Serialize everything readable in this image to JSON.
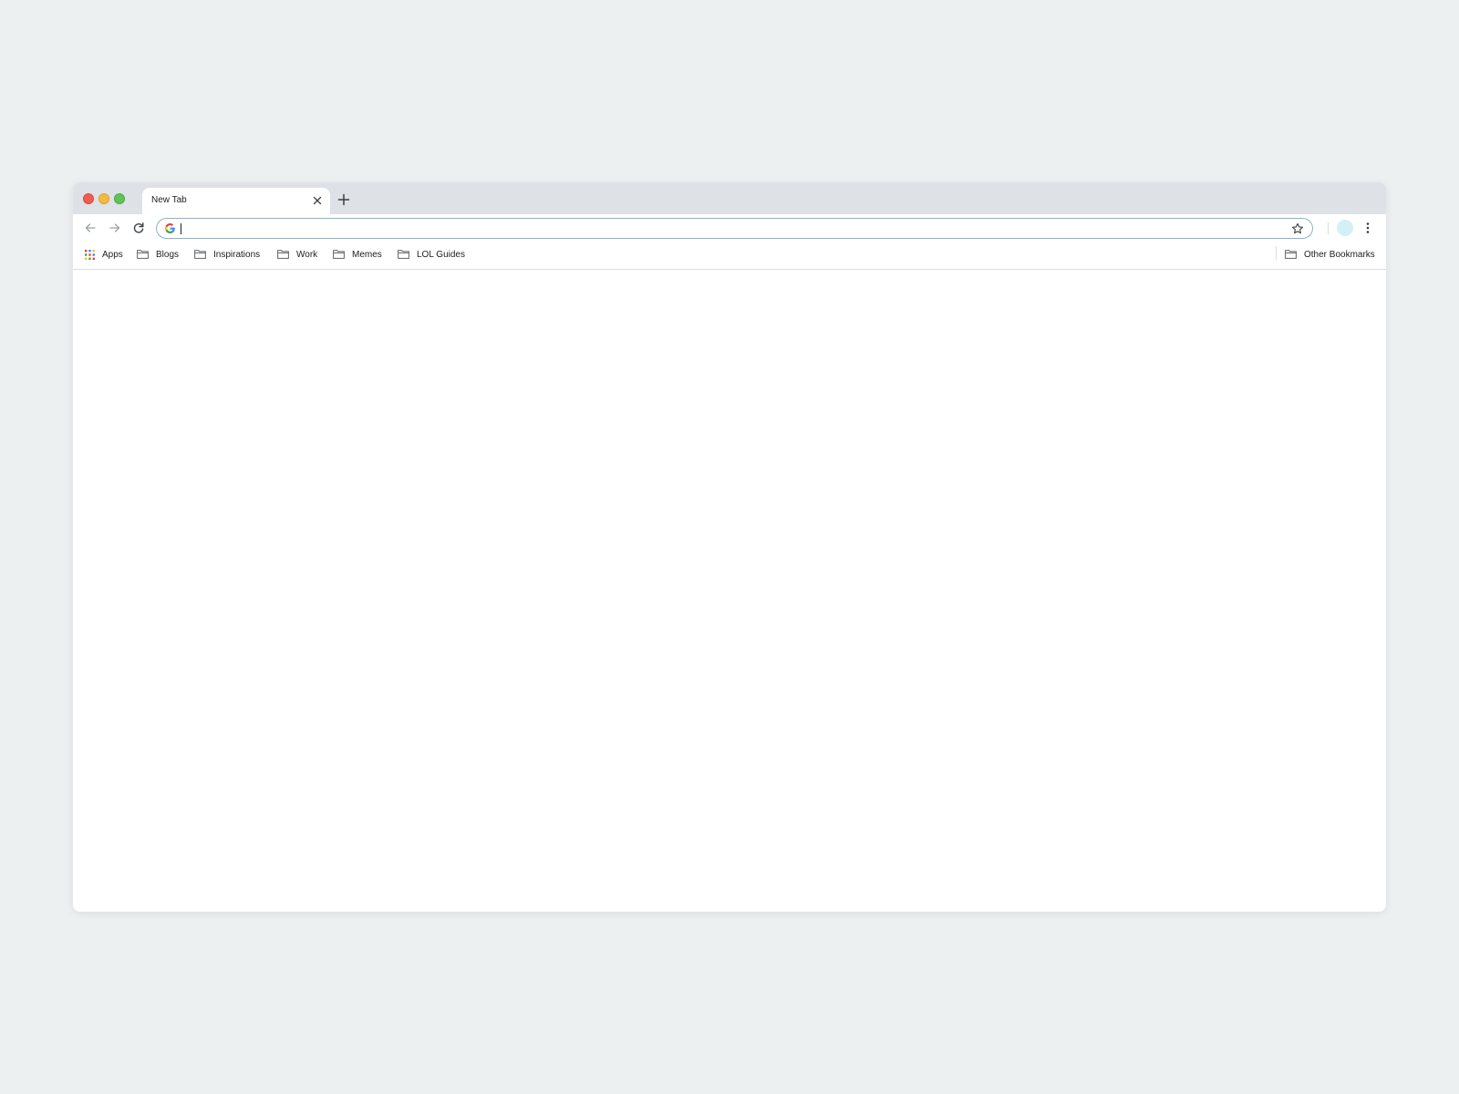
{
  "tab": {
    "title": "New Tab",
    "close_icon": "close-icon",
    "new_tab_icon": "plus-icon"
  },
  "toolbar": {
    "back_icon": "arrow-left-icon",
    "forward_icon": "arrow-right-icon",
    "reload_icon": "reload-icon",
    "omnibox": {
      "value": "",
      "placeholder": "",
      "provider_icon": "google-g-icon"
    },
    "bookmark_star_icon": "star-outline-icon",
    "menu_icon": "vertical-dots-icon"
  },
  "bookmarks": {
    "apps": {
      "label": "Apps",
      "icon": "apps-grid-icon"
    },
    "items": [
      {
        "label": "Blogs",
        "icon": "folder-icon"
      },
      {
        "label": "Inspirations",
        "icon": "folder-icon"
      },
      {
        "label": "Work",
        "icon": "folder-icon"
      },
      {
        "label": "Memes",
        "icon": "folder-icon"
      },
      {
        "label": "LOL Guides",
        "icon": "folder-icon"
      }
    ],
    "other": {
      "label": "Other Bookmarks",
      "icon": "folder-icon"
    }
  },
  "colors": {
    "page_background": "#edf0f1",
    "tab_strip": "#dee1e6",
    "traffic_close": "#ee5d50",
    "traffic_minimize": "#f5b940",
    "traffic_maximize": "#5ec454",
    "omnibox_border": "#8ab4c4",
    "avatar": "#d3f1f4"
  }
}
